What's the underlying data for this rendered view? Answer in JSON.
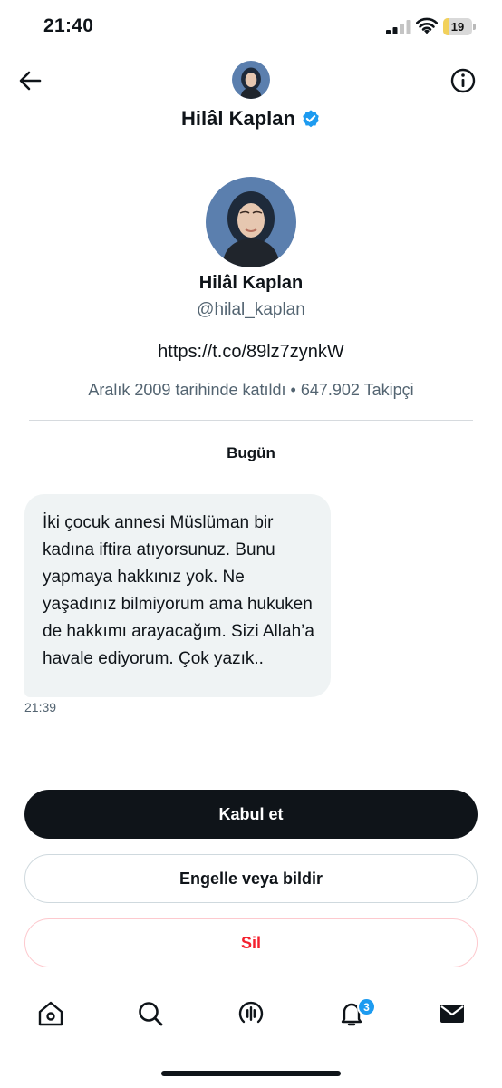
{
  "status_bar": {
    "time": "21:40",
    "battery_level": "19",
    "battery_fraction": 0.19,
    "icons": [
      "signal-icon",
      "wifi-icon",
      "battery-icon"
    ]
  },
  "header": {
    "name": "Hilâl Kaplan",
    "verified": true,
    "icons": [
      "back-arrow-icon",
      "info-icon",
      "verified-badge-icon"
    ]
  },
  "profile": {
    "name": "Hilâl Kaplan",
    "handle": "@hilal_kaplan",
    "link": "https://t.co/89lz7zynkW",
    "meta": "Aralık 2009 tarihinde katıldı • 647.902 Takipçi"
  },
  "conversation": {
    "date_separator": "Bugün",
    "messages": [
      {
        "text": "İki çocuk annesi Müslüman bir kadına iftira atıyorsunuz. Bunu yapmaya hakkınız yok. Ne yaşadınız bilmiyorum ama hukuken de hakkımı arayacağım. Sizi Allah’a havale ediyorum. Çok yazık..",
        "time": "21:39"
      }
    ]
  },
  "actions": {
    "accept_label": "Kabul et",
    "block_label": "Engelle veya bildir",
    "delete_label": "Sil"
  },
  "tab_bar": {
    "tabs": [
      "home-icon",
      "search-icon",
      "spaces-icon",
      "notifications-icon",
      "messages-icon"
    ],
    "notifications_badge": "3"
  },
  "colors": {
    "accent": "#1d9bf0",
    "text": "#0f1419",
    "secondary_text": "#536471",
    "bubble": "#eff3f4",
    "danger": "#f4212e"
  }
}
